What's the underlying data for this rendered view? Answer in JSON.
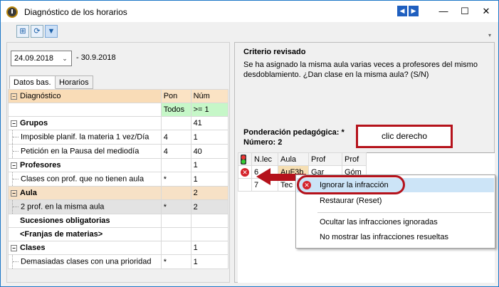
{
  "window": {
    "title": "Diagnóstico de los horarios",
    "nav_prev": "◀",
    "nav_next": "▶",
    "minimize": "—",
    "maximize": "☐",
    "close": "✕"
  },
  "toolbar": {
    "icons": [
      "expand-icon",
      "refresh-icon",
      "filter-icon"
    ]
  },
  "date": {
    "value": "24.09.2018",
    "range_end": "- 30.9.2018"
  },
  "tabs": [
    "Datos bas.",
    "Horarios"
  ],
  "grid": {
    "headers": {
      "diag": "Diagnóstico",
      "pon": "Pon",
      "num": "Núm"
    },
    "filter": {
      "pon": "Todos",
      "num": ">= 1"
    },
    "rows": [
      {
        "label": "Grupos",
        "pon": "",
        "num": "41"
      },
      {
        "label": "Imposible planif. la materia 1 vez/Día",
        "pon": "4",
        "num": "1"
      },
      {
        "label": "Petición en la Pausa del mediodía",
        "pon": "4",
        "num": "40"
      },
      {
        "label": "Profesores",
        "pon": "",
        "num": "1"
      },
      {
        "label": "Clases con prof. que no tienen aula",
        "pon": "*",
        "num": "1"
      },
      {
        "label": "Aula",
        "pon": "",
        "num": "2"
      },
      {
        "label": "2 prof. en la misma aula",
        "pon": "*",
        "num": "2"
      },
      {
        "label": "Sucesiones obligatorias",
        "pon": "",
        "num": ""
      },
      {
        "label": "<Franjas de materias>",
        "pon": "",
        "num": ""
      },
      {
        "label": "Clases",
        "pon": "",
        "num": "1"
      },
      {
        "label": "Demasiadas clases con una prioridad",
        "pon": "*",
        "num": "1"
      }
    ]
  },
  "criterion": {
    "title": "Criterio revisado",
    "text": "Se ha asignado la misma aula varias veces a profesores del mismo desdoblamiento. ¿Dan clase en la misma aula? (S/N)",
    "weight_label": "Ponderación pedagógica: *",
    "number_label": "Número: 2"
  },
  "callout": "clic derecho",
  "detail": {
    "headers": {
      "nlec": "N.lec",
      "aula": "Aula",
      "prof1": "Prof",
      "prof2": "Prof"
    },
    "rows": [
      {
        "nlec": "6",
        "aula": "AuF3b",
        "prof1": "Gar",
        "prof2": "Góm"
      },
      {
        "nlec": "7",
        "aula": "Tec",
        "prof1": "",
        "prof2": ""
      }
    ]
  },
  "menu": {
    "ignore": "Ignorar la infracción",
    "restore": "Restaurar (Reset)",
    "hide": "Ocultar las infracciones ignoradas",
    "nohide": "No mostrar las infracciones resueltas"
  },
  "colors": {
    "accent": "#b5121b",
    "highlight": "#cce4f7",
    "header": "#fbe3c4",
    "filter": "#c6f7c8"
  }
}
